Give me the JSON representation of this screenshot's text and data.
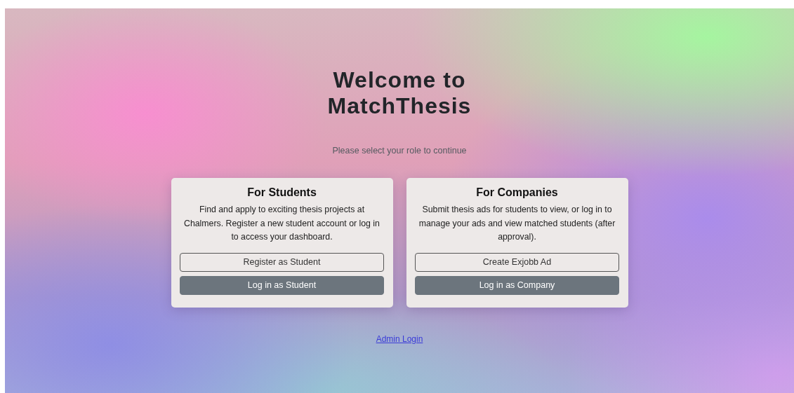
{
  "title_lines": [
    "Welcome to",
    "MatchThesis"
  ],
  "subtitle": "Please select your role to continue",
  "cards": [
    {
      "title": "For Students",
      "text": "Find and apply to exciting thesis projects at Chalmers. Register a new student account or log in to access your dashboard.",
      "buttons": [
        {
          "label": "Register as Student",
          "kind": "outline"
        },
        {
          "label": "Log in as Student",
          "kind": "filled"
        }
      ]
    },
    {
      "title": "For Companies",
      "text": "Submit thesis ads for students to view, or log in to manage your ads and view matched students (after approval).",
      "buttons": [
        {
          "label": "Create Exjobb Ad",
          "kind": "outline"
        },
        {
          "label": "Log in as Company",
          "kind": "filled"
        }
      ]
    }
  ],
  "admin_link": "Admin Login"
}
